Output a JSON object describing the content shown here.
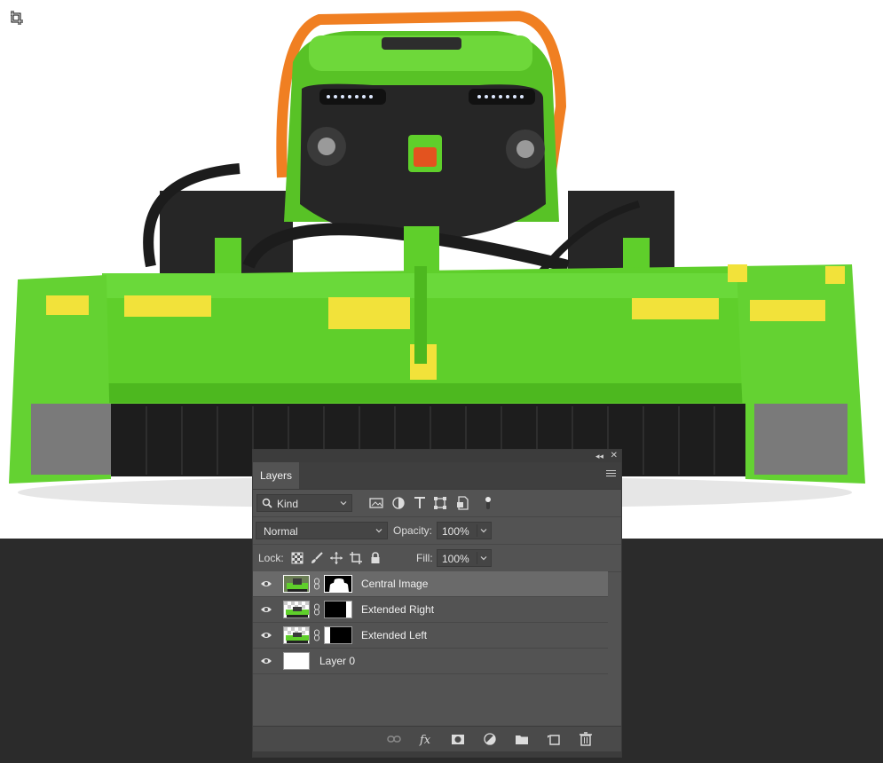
{
  "panel": {
    "tab_label": "Layers",
    "filter": {
      "kind_label": "Kind"
    },
    "blend": {
      "mode": "Normal",
      "opacity_label": "Opacity:",
      "opacity_value": "100%"
    },
    "lock": {
      "lock_label": "Lock:",
      "fill_label": "Fill:",
      "fill_value": "100%"
    },
    "layers": [
      {
        "name": "Central Image",
        "selected": true
      },
      {
        "name": "Extended Right",
        "selected": false
      },
      {
        "name": "Extended Left",
        "selected": false
      },
      {
        "name": "Layer 0",
        "selected": false
      }
    ]
  },
  "icons": {
    "filter": [
      "image-filter-icon",
      "adjustment-filter-icon",
      "type-filter-icon",
      "shape-filter-icon",
      "smart-object-filter-icon",
      "filter-toggle-icon"
    ],
    "lock": [
      "lock-transparent-icon",
      "lock-paint-icon",
      "lock-position-icon",
      "lock-artboard-icon",
      "lock-all-icon"
    ],
    "footer": [
      "link-layers-icon",
      "fx-icon",
      "add-mask-icon",
      "adjustment-layer-icon",
      "new-group-icon",
      "new-layer-icon",
      "delete-icon"
    ]
  },
  "colors": {
    "machine_green": "#5fcf2b",
    "panel_bg": "#535353",
    "workspace_bg": "#2b2b2b"
  }
}
